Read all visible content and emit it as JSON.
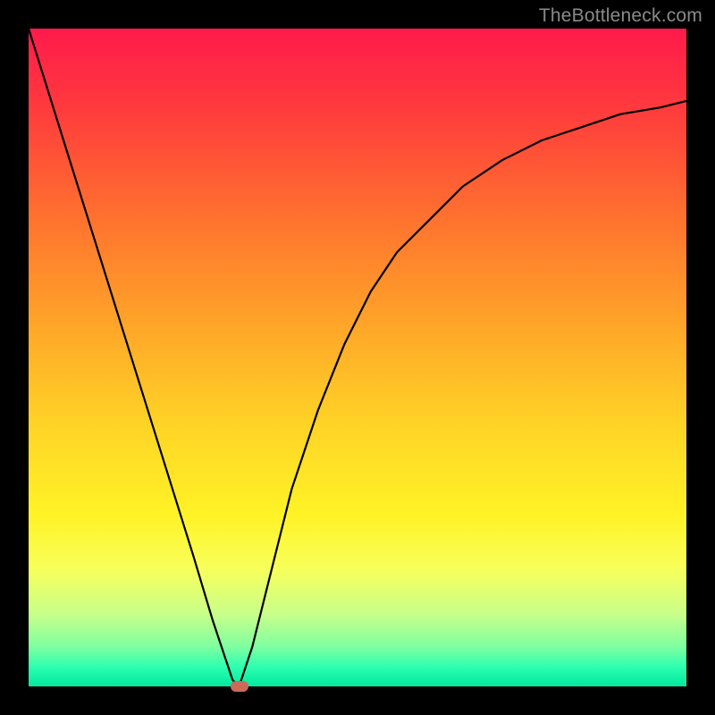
{
  "watermark": "TheBottleneck.com",
  "chart_data": {
    "type": "line",
    "title": "",
    "xlabel": "",
    "ylabel": "",
    "xlim": [
      0,
      100
    ],
    "ylim": [
      0,
      100
    ],
    "grid": false,
    "legend": false,
    "background_gradient": {
      "top": "#ff1a4b",
      "bottom": "#00e8a0"
    },
    "series": [
      {
        "name": "curve",
        "x": [
          0,
          5,
          10,
          15,
          20,
          25,
          28,
          30,
          31,
          32,
          34,
          36,
          38,
          40,
          44,
          48,
          52,
          56,
          60,
          66,
          72,
          78,
          84,
          90,
          96,
          100
        ],
        "values": [
          100,
          84,
          68,
          52,
          36,
          20,
          10,
          4,
          1,
          0,
          6,
          14,
          22,
          30,
          42,
          52,
          60,
          66,
          70,
          76,
          80,
          83,
          85,
          87,
          88,
          89
        ]
      }
    ],
    "marker": {
      "x": 32,
      "y": 0,
      "color": "#cc6a5a"
    },
    "minimum_x": 32
  }
}
